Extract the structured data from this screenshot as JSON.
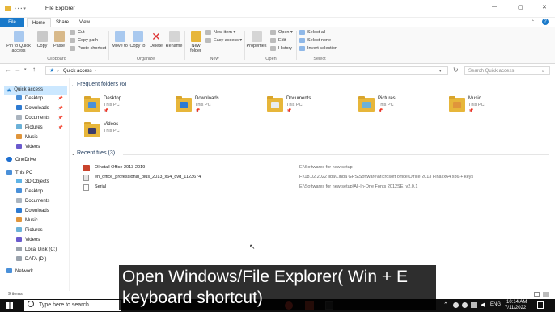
{
  "window": {
    "title": "File Explorer",
    "controls": {
      "minimize": "—",
      "maximize": "▢",
      "close": "✕"
    }
  },
  "menu_tabs": [
    "File",
    "Home",
    "Share",
    "View"
  ],
  "ribbon": {
    "clipboard": {
      "pin_label": "Pin to Quick access",
      "copy_label": "Copy",
      "paste_label": "Paste",
      "cut_label": "Cut",
      "copy_path_label": "Copy path",
      "paste_shortcut_label": "Paste shortcut",
      "group_label": "Clipboard"
    },
    "organize": {
      "move_to_label": "Move to",
      "copy_to_label": "Copy to",
      "delete_label": "Delete",
      "rename_label": "Rename",
      "group_label": "Organize"
    },
    "new": {
      "new_folder_label": "New folder",
      "new_item_label": "New item",
      "easy_access_label": "Easy access",
      "group_label": "New"
    },
    "open": {
      "properties_label": "Properties",
      "open_label": "Open",
      "edit_label": "Edit",
      "history_label": "History",
      "group_label": "Open"
    },
    "select": {
      "select_all_label": "Select all",
      "select_none_label": "Select none",
      "invert_label": "Invert selection",
      "group_label": "Select"
    }
  },
  "address": {
    "path": "Quick access",
    "search_placeholder": "Search Quick access"
  },
  "nav": {
    "quick_access": "Quick access",
    "quick_items": [
      {
        "label": "Desktop",
        "pinned": true
      },
      {
        "label": "Downloads",
        "pinned": true
      },
      {
        "label": "Documents",
        "pinned": true
      },
      {
        "label": "Pictures",
        "pinned": true
      },
      {
        "label": "Music",
        "pinned": false
      },
      {
        "label": "Videos",
        "pinned": false
      }
    ],
    "onedrive": "OneDrive",
    "this_pc": "This PC",
    "pc_items": [
      "3D Objects",
      "Desktop",
      "Documents",
      "Downloads",
      "Music",
      "Pictures",
      "Videos",
      "Local Disk (C:)",
      "DATA (D:)"
    ],
    "network": "Network"
  },
  "frequent": {
    "header": "Frequent folders (6)",
    "folders": [
      {
        "name": "Desktop",
        "location": "This PC",
        "pin": "📌"
      },
      {
        "name": "Downloads",
        "location": "This PC",
        "pin": "📌"
      },
      {
        "name": "Documents",
        "location": "This PC",
        "pin": "📌"
      },
      {
        "name": "Pictures",
        "location": "This PC",
        "pin": "📌"
      },
      {
        "name": "Music",
        "location": "This PC",
        "pin": "📌"
      },
      {
        "name": "Videos",
        "location": "This PC",
        "pin": ""
      }
    ]
  },
  "recent": {
    "header": "Recent files (3)",
    "files": [
      {
        "name": "OInstall Office 2013-2019",
        "path": "E:\\Softwares for new setup"
      },
      {
        "name": "en_office_professional_plus_2013_x64_dvd_1123674",
        "path": "F:\\18.02.2022 lida\\Linda GPS\\Software\\Microsoft office\\Office 2013 Final x64 x86 + keys"
      },
      {
        "name": "Serial",
        "path": "E:\\Softwares for new setup\\All-In-One Fonts 2012SE_v2.0.1"
      }
    ]
  },
  "status": {
    "items_count": "9 items"
  },
  "taskbar": {
    "search_placeholder": "Type here to search",
    "language": "ENG",
    "time": "10:14 AM",
    "date": "7/11/2022"
  },
  "caption": {
    "line1": "Open Windows/File Explorer( Win + E",
    "line2": "keyboard shortcut)"
  },
  "colors": {
    "accent": "#1979ca",
    "folder": "#e7b63a",
    "selected": "#cce8ff",
    "taskbar": "#101010"
  }
}
